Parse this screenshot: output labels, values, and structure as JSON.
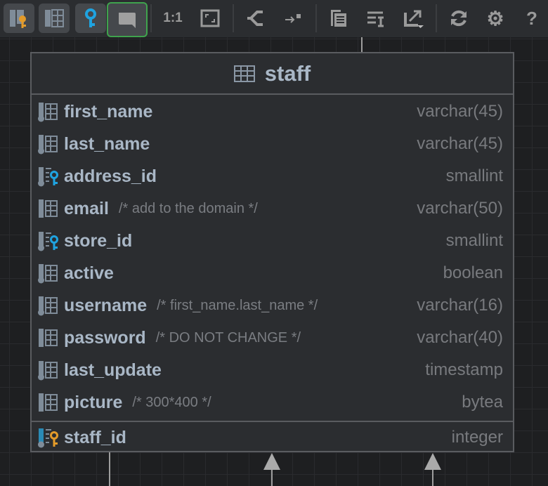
{
  "toolbar": {
    "items": [
      {
        "name": "show-keys-toggle",
        "icon": "column-key-icon"
      },
      {
        "name": "show-columns-toggle",
        "icon": "columns-icon"
      },
      {
        "name": "show-key-toggle",
        "icon": "key-icon"
      },
      {
        "name": "show-comments-toggle",
        "icon": "comment-icon"
      },
      {
        "name": "actual-size-button",
        "label": "1:1"
      },
      {
        "name": "fit-content-button",
        "icon": "fit-icon"
      },
      {
        "name": "layout-button",
        "icon": "layout-icon"
      },
      {
        "name": "move-button",
        "icon": "arrow-to-icon"
      },
      {
        "name": "copy-button",
        "icon": "copy-icon"
      },
      {
        "name": "edit-button",
        "icon": "edit-text-icon"
      },
      {
        "name": "export-button",
        "icon": "export-icon"
      },
      {
        "name": "refresh-button",
        "icon": "refresh-icon"
      },
      {
        "name": "settings-button",
        "icon": "gear-icon"
      },
      {
        "name": "help-button",
        "label": "?"
      }
    ]
  },
  "table": {
    "title": "staff",
    "columns": [
      {
        "name": "first_name",
        "comment": "",
        "type": "varchar(45)",
        "kind": "column"
      },
      {
        "name": "last_name",
        "comment": "",
        "type": "varchar(45)",
        "kind": "column"
      },
      {
        "name": "address_id",
        "comment": "",
        "type": "smallint",
        "kind": "fk"
      },
      {
        "name": "email",
        "comment": "/* add to the domain */",
        "type": "varchar(50)",
        "kind": "column-plain"
      },
      {
        "name": "store_id",
        "comment": "",
        "type": "smallint",
        "kind": "fk"
      },
      {
        "name": "active",
        "comment": "",
        "type": "boolean",
        "kind": "column"
      },
      {
        "name": "username",
        "comment": "/* first_name.last_name */",
        "type": "varchar(16)",
        "kind": "column"
      },
      {
        "name": "password",
        "comment": "/* DO NOT CHANGE */",
        "type": "varchar(40)",
        "kind": "column-plain"
      },
      {
        "name": "last_update",
        "comment": "",
        "type": "timestamp",
        "kind": "column"
      },
      {
        "name": "picture",
        "comment": "/* 300*400 */",
        "type": "bytea",
        "kind": "column-plain"
      }
    ],
    "primary_key": {
      "name": "staff_id",
      "type": "integer"
    }
  },
  "colors": {
    "selected": "#3fa34d",
    "key_gold": "#e39b2a",
    "key_blue": "#1fa3e0"
  }
}
